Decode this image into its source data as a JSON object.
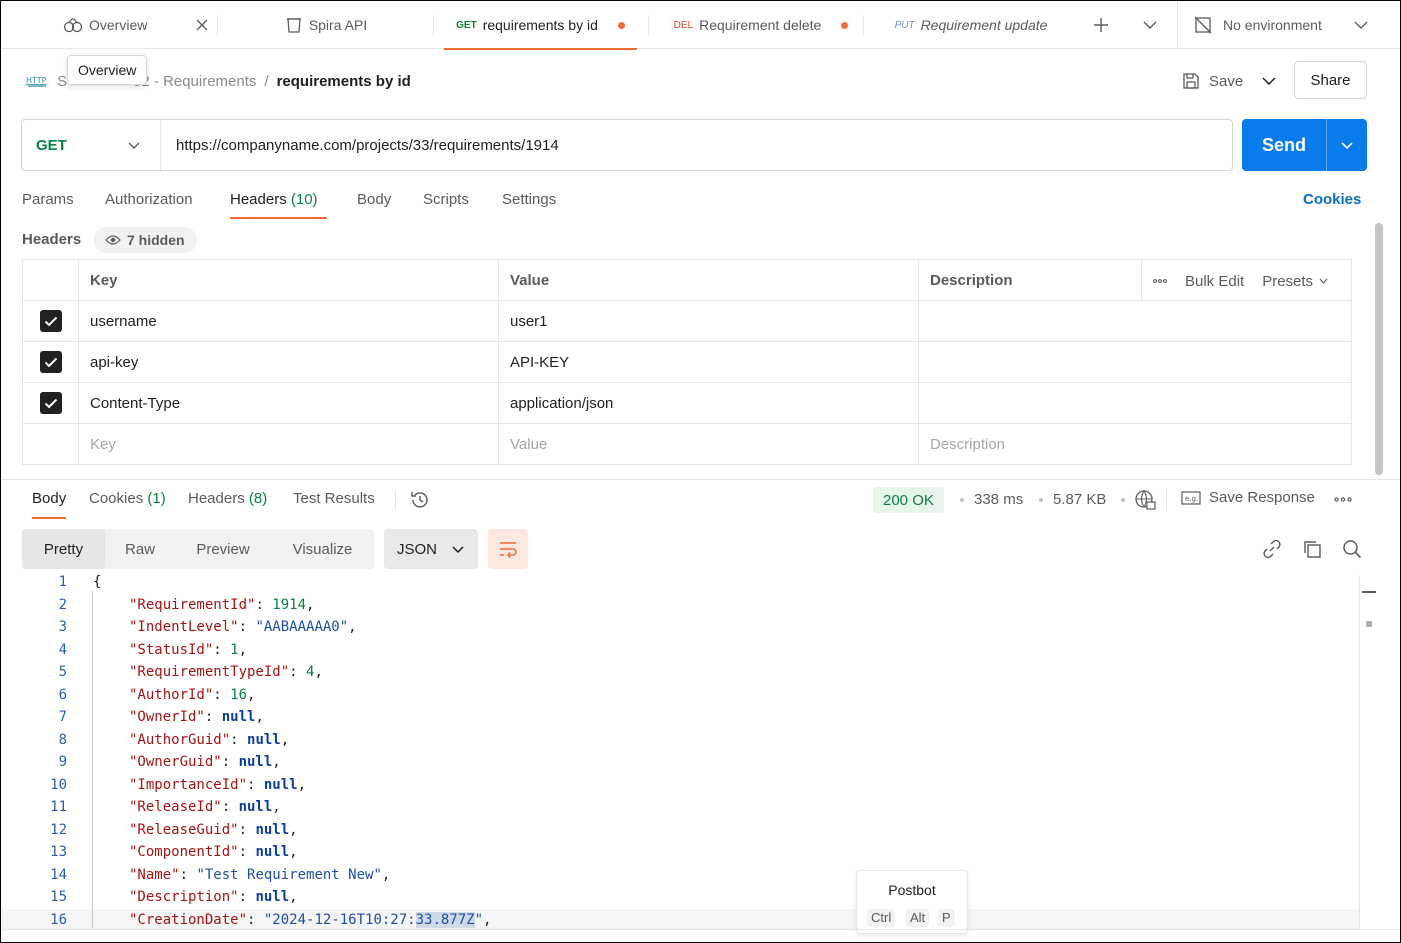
{
  "tabs": [
    {
      "label": "Overview"
    },
    {
      "label": "Spira API"
    },
    {
      "method": "GET",
      "label": "requirements by id",
      "method_color": "#0b8043"
    },
    {
      "method": "DEL",
      "label": "Requirement delete",
      "method_color": "#d9412e"
    },
    {
      "method": "PUT",
      "label": "Requirement update",
      "method_color": "#6a8cc9"
    }
  ],
  "environment": "No environment",
  "tooltip": "Overview",
  "breadcrumb": {
    "http_badge": "HTTP",
    "parent_visible": "02 - Requirements",
    "prefix_visible": "S",
    "separator": "/",
    "current": "requirements by id"
  },
  "actions": {
    "save": "Save",
    "share": "Share"
  },
  "request": {
    "method": "GET",
    "url": "https://companyname.com/projects/33/requirements/1914",
    "send": "Send"
  },
  "request_tabs": [
    {
      "label": "Params"
    },
    {
      "label": "Authorization"
    },
    {
      "label": "Headers",
      "count": "(10)"
    },
    {
      "label": "Body"
    },
    {
      "label": "Scripts"
    },
    {
      "label": "Settings"
    }
  ],
  "cookies_link": "Cookies",
  "headers": {
    "title": "Headers",
    "hidden": "7 hidden",
    "columns": {
      "key": "Key",
      "value": "Value",
      "description": "Description",
      "bulk_edit": "Bulk Edit",
      "presets": "Presets"
    },
    "rows": [
      {
        "key": "username",
        "value": "user1",
        "checked": true
      },
      {
        "key": "api-key",
        "value": "API-KEY",
        "checked": true
      },
      {
        "key": "Content-Type",
        "value": "application/json",
        "checked": true
      }
    ],
    "placeholder": {
      "key": "Key",
      "value": "Value",
      "description": "Description"
    }
  },
  "response_tabs": [
    {
      "label": "Body"
    },
    {
      "label": "Cookies",
      "count": "(1)"
    },
    {
      "label": "Headers",
      "count": "(8)"
    },
    {
      "label": "Test Results"
    }
  ],
  "response_meta": {
    "status": "200 OK",
    "time": "338 ms",
    "size": "5.87 KB",
    "save_response": "Save Response"
  },
  "view_modes": [
    "Pretty",
    "Raw",
    "Preview",
    "Visualize"
  ],
  "format": "JSON",
  "code_lines": [
    {
      "n": "1",
      "text": "{"
    },
    {
      "n": "2",
      "key": "\"RequirementId\"",
      "val": "1914",
      "type": "num"
    },
    {
      "n": "3",
      "key": "\"IndentLevel\"",
      "val": "\"AABAAAAA0\"",
      "type": "str"
    },
    {
      "n": "4",
      "key": "\"StatusId\"",
      "val": "1",
      "type": "num"
    },
    {
      "n": "5",
      "key": "\"RequirementTypeId\"",
      "val": "4",
      "type": "num"
    },
    {
      "n": "6",
      "key": "\"AuthorId\"",
      "val": "16",
      "type": "num"
    },
    {
      "n": "7",
      "key": "\"OwnerId\"",
      "val": "null",
      "type": "null"
    },
    {
      "n": "8",
      "key": "\"AuthorGuid\"",
      "val": "null",
      "type": "null"
    },
    {
      "n": "9",
      "key": "\"OwnerGuid\"",
      "val": "null",
      "type": "null"
    },
    {
      "n": "10",
      "key": "\"ImportanceId\"",
      "val": "null",
      "type": "null"
    },
    {
      "n": "11",
      "key": "\"ReleaseId\"",
      "val": "null",
      "type": "null"
    },
    {
      "n": "12",
      "key": "\"ReleaseGuid\"",
      "val": "null",
      "type": "null"
    },
    {
      "n": "13",
      "key": "\"ComponentId\"",
      "val": "null",
      "type": "null"
    },
    {
      "n": "14",
      "key": "\"Name\"",
      "val": "\"Test Requirement New\"",
      "type": "str"
    },
    {
      "n": "15",
      "key": "\"Description\"",
      "val": "null",
      "type": "null"
    },
    {
      "n": "16",
      "key": "\"CreationDate\"",
      "val": "\"2024-12-16T10:27:33.877Z\"",
      "type": "str"
    }
  ],
  "postbot": {
    "title": "Postbot",
    "keys": [
      "Ctrl",
      "Alt",
      "P"
    ]
  }
}
